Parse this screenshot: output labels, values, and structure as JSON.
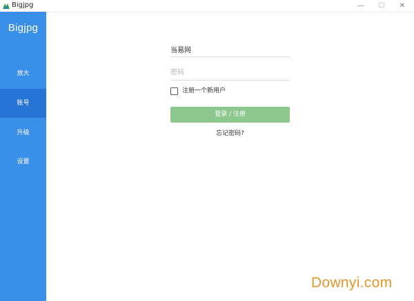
{
  "window": {
    "title": "Bigjpg",
    "minimize_glyph": "—",
    "maximize_glyph": "☐",
    "close_glyph": "✕"
  },
  "sidebar": {
    "brand": "Bigjpg",
    "items": [
      {
        "label": "放大",
        "active": false
      },
      {
        "label": "账号",
        "active": true
      },
      {
        "label": "升级",
        "active": false
      },
      {
        "label": "设置",
        "active": false
      }
    ]
  },
  "login": {
    "username_value": "当易网",
    "password_placeholder": "密码",
    "register_checkbox_label": "注册一个新用户",
    "register_checked": false,
    "submit_label": "登录 / 注册",
    "forgot_label": "忘记密码?"
  },
  "watermark": {
    "text": "Downyi.com"
  },
  "colors": {
    "sidebar_bg": "#3a8fe8",
    "sidebar_active_bg": "#2674d6",
    "button_bg": "#8cc78e",
    "watermark": "#e3962a"
  },
  "icons": {
    "app_icon": "bigjpg-logo-icon",
    "window_controls": [
      "minimize-icon",
      "maximize-icon",
      "close-icon"
    ]
  }
}
